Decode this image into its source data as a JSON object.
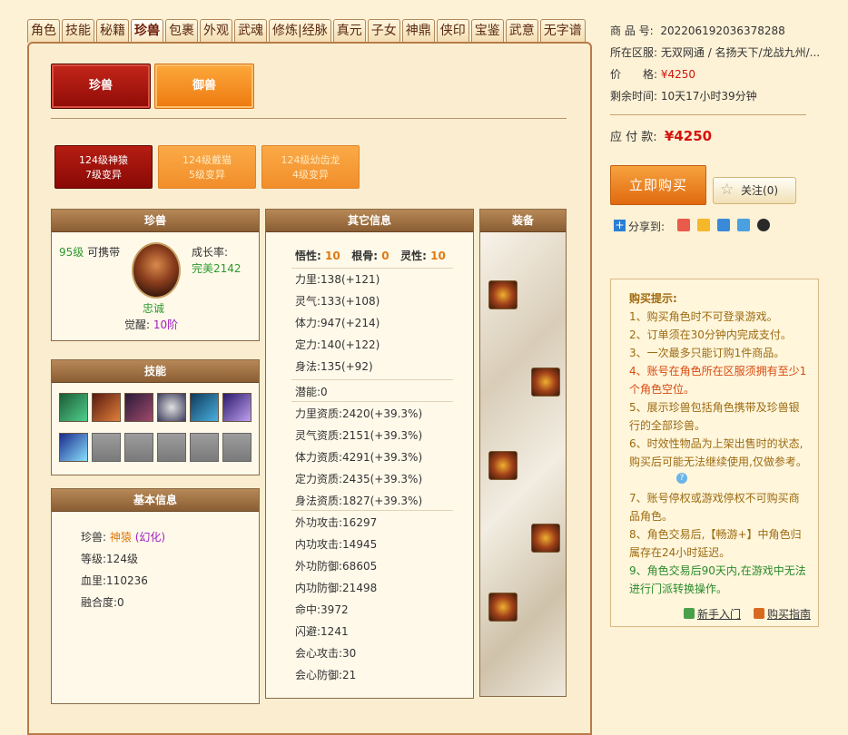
{
  "tabs": [
    "角色",
    "技能",
    "秘籍",
    "珍兽",
    "包裹",
    "外观",
    "武魂",
    "修炼|经脉",
    "真元",
    "子女",
    "神鼎",
    "侠印",
    "宝鉴",
    "武意",
    "无字谱"
  ],
  "active_tab": "珍兽",
  "top_buttons": {
    "pet": "珍兽",
    "mount": "御兽"
  },
  "pets": [
    {
      "line1": "124级神猿",
      "line2": "7级变异"
    },
    {
      "line1": "124级戴猫",
      "line2": "5级变异"
    },
    {
      "line1": "124级幼齿龙",
      "line2": "4级变异"
    }
  ],
  "pet_panel": {
    "title": "珍兽",
    "level": "95级",
    "carry": "可携带",
    "growth_label": "成长率:",
    "growth_value": "完美2142",
    "loyalty": "忠诚",
    "awaken_label": "觉醒:",
    "awaken_value": "10阶"
  },
  "skills_panel": {
    "title": "技能"
  },
  "basic_panel": {
    "title": "基本信息",
    "pet_label": "珍兽:",
    "pet_value": "神猿",
    "pet_extra": "(幻化)",
    "level_label": "等级:",
    "level_value": "124级",
    "hp_label": "血里:",
    "hp_value": "110236",
    "fusion_label": "融合度:",
    "fusion_value": "0"
  },
  "other_panel": {
    "title": "其它信息",
    "wux_label": "悟性:",
    "wux_value": "10",
    "gengu_label": "根骨:",
    "gengu_value": "0",
    "lingx_label": "灵性:",
    "lingx_value": "10",
    "stats": [
      "力里:138(+121)",
      "灵气:133(+108)",
      "体力:947(+214)",
      "定力:140(+122)",
      "身法:135(+92)"
    ],
    "potential": "潜能:0",
    "aptitudes": [
      "力里资质:2420(+39.3%)",
      "灵气资质:2151(+39.3%)",
      "体力资质:4291(+39.3%)",
      "定力资质:2435(+39.3%)",
      "身法资质:1827(+39.3%)"
    ],
    "combat": [
      "外功攻击:16297",
      "内功攻击:14945",
      "外功防御:68605",
      "内功防御:21498",
      "命中:3972",
      "闪避:1241",
      "会心攻击:30",
      "会心防御:21"
    ]
  },
  "equip_panel": {
    "title": "装备"
  },
  "listing": {
    "id_label": "商 品 号:",
    "id_value": "202206192036378288",
    "server_label": "所在区服:",
    "server_value": "无双网通 / 名扬天下/龙战九州/...",
    "price_label": "价　　格:",
    "price_value": "¥4250",
    "time_label": "剩余时间:",
    "time_value": "10天17小时39分钟",
    "pay_label": "应 付 款:",
    "pay_value": "¥4250",
    "buy_label": "立即购买",
    "follow_label": "关注",
    "follow_count": "(0)",
    "share_label": "分享到:"
  },
  "tips": {
    "title": "购买提示:",
    "items": [
      "1、购买角色时不可登录游戏。",
      "2、订单须在30分钟内完成支付。",
      "3、一次最多只能订购1件商品。",
      "4、账号在角色所在区服须拥有至少1个角色空位。",
      "5、展示珍兽包括角色携带及珍兽银行的全部珍兽。",
      "6、时效性物品为上架出售时的状态,购买后可能无法继续使用,仅做参考。",
      "7、账号停权或游戏停权不可购买商品角色。",
      "8、角色交易后,【畅游+】中角色归属存在24小时延迟。",
      "9、角色交易后90天内,在游戏中无法进行门派转换操作。"
    ],
    "newbie": "新手入门",
    "guide": "购买指南"
  },
  "colors": {
    "accent_red": "#d4140d",
    "frame": "#b97b47",
    "tab_active": "#6b1a06"
  }
}
